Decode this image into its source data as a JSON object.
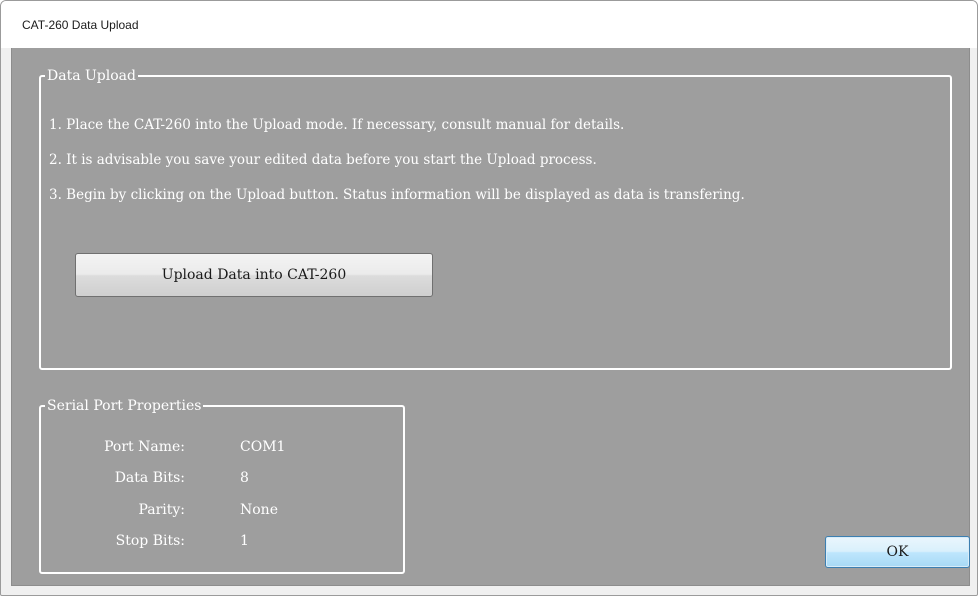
{
  "window": {
    "title": "CAT-260 Data Upload"
  },
  "data_upload": {
    "legend": "Data Upload",
    "instructions": [
      "1. Place the CAT-260 into the Upload mode.  If necessary, consult manual for details.",
      "2. It is advisable you save your edited data before you start the Upload process.",
      "3. Begin by clicking on the Upload button.  Status information will be displayed as data is transfering."
    ],
    "upload_button_label": "Upload Data into CAT-260"
  },
  "serial_port": {
    "legend": "Serial Port Properties",
    "properties": [
      {
        "label": "Port Name:",
        "value": "COM1"
      },
      {
        "label": "Data Bits:",
        "value": "8"
      },
      {
        "label": "Parity:",
        "value": "None"
      },
      {
        "label": "Stop Bits:",
        "value": "1"
      }
    ]
  },
  "footer": {
    "ok_label": "OK"
  },
  "colors": {
    "client_background": "#9e9e9e",
    "text": "#ffffff",
    "ok_button_border": "#3c7fb1"
  }
}
